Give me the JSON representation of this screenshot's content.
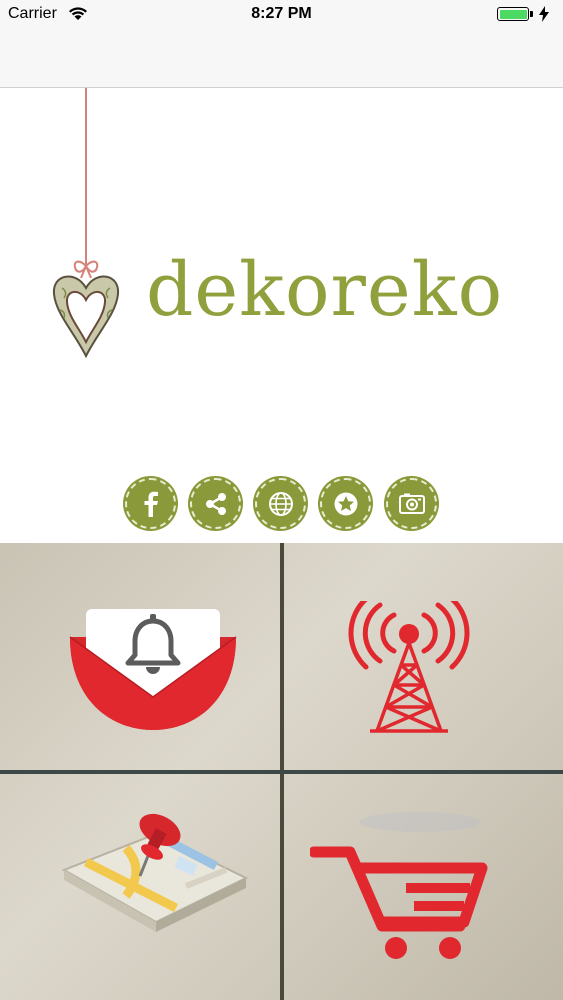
{
  "status_bar": {
    "carrier": "Carrier",
    "time": "8:27 PM",
    "battery_color": "#4cd964"
  },
  "brand": {
    "name": "dekoreko",
    "color": "#8fa03c"
  },
  "social": [
    {
      "icon": "facebook-icon"
    },
    {
      "icon": "share-icon"
    },
    {
      "icon": "globe-icon"
    },
    {
      "icon": "star-icon"
    },
    {
      "icon": "camera-icon"
    }
  ],
  "tiles": [
    {
      "icon": "notification-envelope-icon"
    },
    {
      "icon": "radio-tower-icon"
    },
    {
      "icon": "map-pin-icon"
    },
    {
      "icon": "shopping-cart-icon"
    }
  ],
  "colors": {
    "accent_red": "#e0282e",
    "olive": "#8a9a3a"
  }
}
